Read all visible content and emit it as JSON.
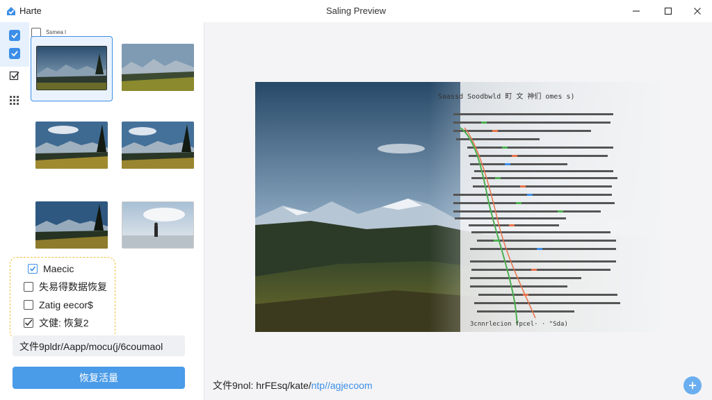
{
  "window": {
    "app_name": "Harte",
    "title": "Saling Preview"
  },
  "sidebar": {
    "select_all_label": "Ssmea l",
    "options": [
      {
        "label": "Maecic",
        "checked": true
      },
      {
        "label": "失易得数据恢复",
        "checked": false
      },
      {
        "label": "Zatig eecor$",
        "checked": false
      },
      {
        "label": "文健: 恢复2",
        "checked": true
      }
    ],
    "path_value": "文件9pldr/Aapp/mocu(j/6coumaol",
    "recover_button": "恢复活量"
  },
  "preview": {
    "doc_heading": "Saassd Soodbwld 町 文 神们 omes s)",
    "doc_footer": "3cnnrlecion fpcel·  · \"Sda)"
  },
  "status": {
    "prefix": "文件9nol: ",
    "path": "hrFEsq/kate/",
    "link": "ntp//agjecoom"
  },
  "icons": {
    "app_logo": "house-check-icon",
    "minimize": "minimize-icon",
    "maximize": "maximize-icon",
    "close": "close-icon",
    "grid": "grid-icon",
    "fab": "plus-icon"
  },
  "colors": {
    "accent": "#3c8ee8",
    "button": "#4a9be8",
    "options_border": "#f0c040",
    "doc_green": "#4caf50",
    "doc_orange": "#e8734a"
  }
}
